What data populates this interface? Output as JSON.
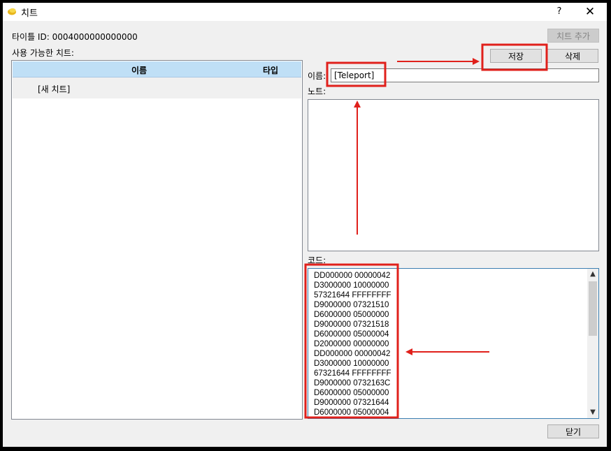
{
  "window": {
    "title": "치트",
    "help_label": "?",
    "close_label": "✕"
  },
  "title_id": "타이틀 ID: 0004000000000000",
  "available_label": "사용 가능한 치트:",
  "buttons": {
    "add_cheat": "치트 추가",
    "save": "저장",
    "delete": "삭제",
    "close": "닫기"
  },
  "list": {
    "columns": [
      "이름",
      "타입"
    ],
    "rows": [
      {
        "name": "[새 치트]",
        "type": ""
      }
    ]
  },
  "fields": {
    "name_label": "이름:",
    "name_value": "[Teleport]",
    "notes_label": "노트:",
    "notes_value": "",
    "code_label": "코드:",
    "code_lines": [
      "DD000000 00000042",
      "D3000000 10000000",
      "57321644 FFFFFFFF",
      "D9000000 07321510",
      "D6000000 05000000",
      "D9000000 07321518",
      "D6000000 05000004",
      "D2000000 00000000",
      "DD000000 00000042",
      "D3000000 10000000",
      "67321644 FFFFFFFF",
      "D9000000 0732163C",
      "D6000000 05000000",
      "D9000000 07321644",
      "D6000000 05000004"
    ]
  },
  "scrollbar": {
    "up_icon": "▲",
    "down_icon": "▼"
  },
  "annotation_color": "#e0201b"
}
